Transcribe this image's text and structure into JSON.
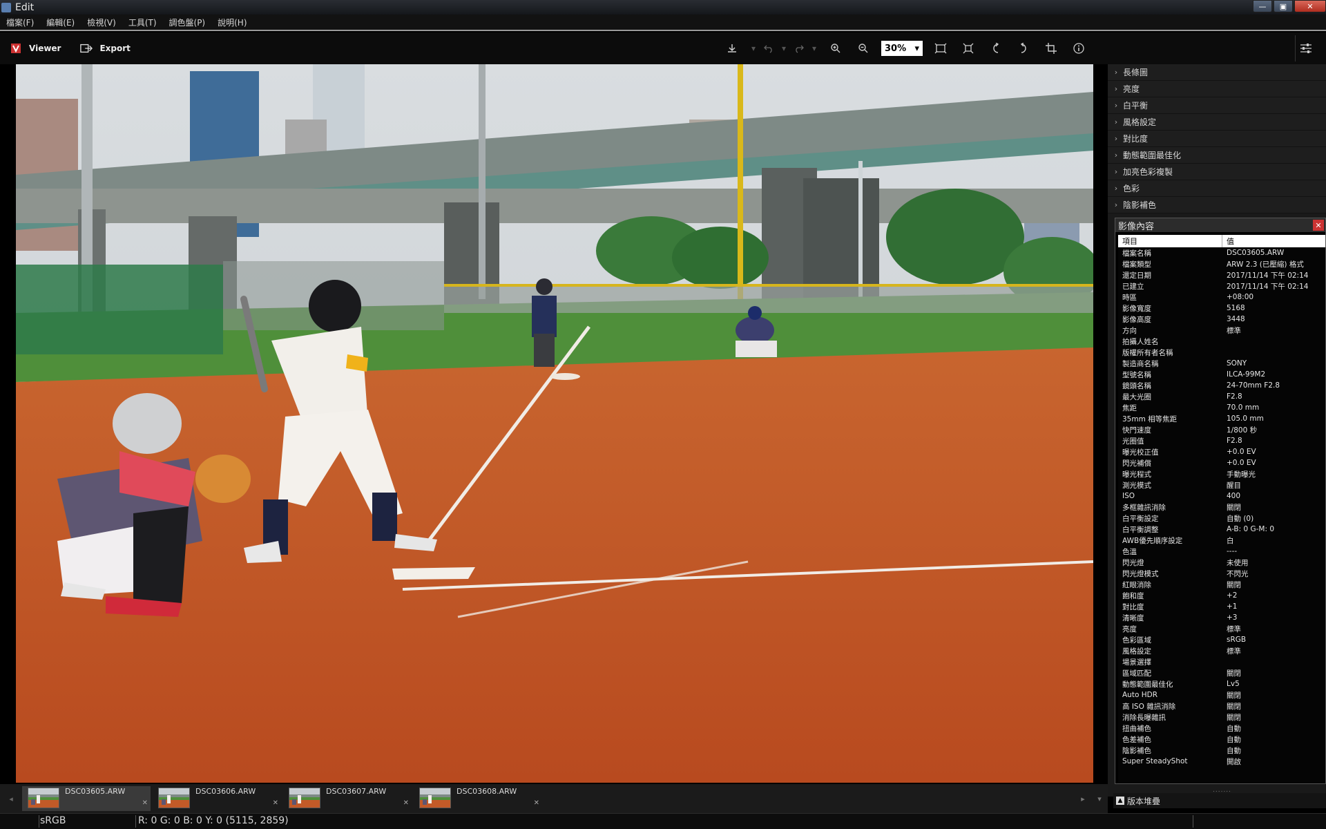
{
  "window": {
    "title": "Edit"
  },
  "menu": [
    "檔案(F)",
    "編輯(E)",
    "檢視(V)",
    "工具(T)",
    "調色盤(P)",
    "說明(H)"
  ],
  "toolbar": {
    "viewer_label": "Viewer",
    "export_label": "Export",
    "zoom_value": "30%"
  },
  "adjustments": [
    "長條圖",
    "亮度",
    "白平衡",
    "風格設定",
    "對比度",
    "動態範圍最佳化",
    "加亮色彩複製",
    "色彩",
    "陰影補色"
  ],
  "properties": {
    "title": "影像內容",
    "col_item": "項目",
    "col_value": "值",
    "rows": [
      {
        "k": "檔案名稱",
        "v": "DSC03605.ARW"
      },
      {
        "k": "檔案類型",
        "v": "ARW 2.3 (已壓縮) 格式"
      },
      {
        "k": "還定日期",
        "v": "2017/11/14 下午 02:14"
      },
      {
        "k": "已建立",
        "v": "2017/11/14 下午 02:14"
      },
      {
        "k": "時區",
        "v": "+08:00"
      },
      {
        "k": "影像寬度",
        "v": "5168"
      },
      {
        "k": "影像高度",
        "v": "3448"
      },
      {
        "k": "方向",
        "v": "標準"
      },
      {
        "k": "拍攝人姓名",
        "v": ""
      },
      {
        "k": "版權所有者名稱",
        "v": ""
      },
      {
        "k": "製造商名稱",
        "v": "SONY"
      },
      {
        "k": "型號名稱",
        "v": "ILCA-99M2"
      },
      {
        "k": "鏡頭名稱",
        "v": "24-70mm F2.8"
      },
      {
        "k": "最大光圈",
        "v": "F2.8"
      },
      {
        "k": "焦距",
        "v": "70.0 mm"
      },
      {
        "k": "35mm 相等焦距",
        "v": "105.0 mm"
      },
      {
        "k": "快門速度",
        "v": "1/800 秒"
      },
      {
        "k": "光圈值",
        "v": "F2.8"
      },
      {
        "k": "曝光校正值",
        "v": "+0.0 EV"
      },
      {
        "k": "閃光補償",
        "v": "+0.0 EV"
      },
      {
        "k": "曝光程式",
        "v": "手動曝光"
      },
      {
        "k": "測光模式",
        "v": "醒目"
      },
      {
        "k": "ISO",
        "v": "400"
      },
      {
        "k": "多框雜訊消除",
        "v": "關閉"
      },
      {
        "k": "白平衡設定",
        "v": "自動 (0)"
      },
      {
        "k": "白平衡調整",
        "v": "A-B: 0 G-M: 0"
      },
      {
        "k": "AWB優先順序設定",
        "v": "白"
      },
      {
        "k": "色溫",
        "v": "----"
      },
      {
        "k": "閃光燈",
        "v": "未使用"
      },
      {
        "k": "閃光燈模式",
        "v": "不閃光"
      },
      {
        "k": "紅眼消除",
        "v": "關閉"
      },
      {
        "k": "飽和度",
        "v": "+2"
      },
      {
        "k": "對比度",
        "v": "+1"
      },
      {
        "k": "清晰度",
        "v": "+3"
      },
      {
        "k": "亮度",
        "v": "標準"
      },
      {
        "k": "色彩區域",
        "v": "sRGB"
      },
      {
        "k": "風格設定",
        "v": "標準"
      },
      {
        "k": "場景選擇",
        "v": ""
      },
      {
        "k": "區域匹配",
        "v": "關閉"
      },
      {
        "k": "動態範圍最佳化",
        "v": "Lv5"
      },
      {
        "k": "Auto HDR",
        "v": "關閉"
      },
      {
        "k": "高 ISO 雜訊消除",
        "v": "關閉"
      },
      {
        "k": "消除長曝雜訊",
        "v": "關閉"
      },
      {
        "k": "扭曲補色",
        "v": "自動"
      },
      {
        "k": "色差補色",
        "v": "自動"
      },
      {
        "k": "陰影補色",
        "v": "自動"
      },
      {
        "k": "Super SteadyShot",
        "v": "開啟"
      }
    ]
  },
  "version_stack_label": "版本堆疊",
  "filmstrip": [
    {
      "name": "DSC03605.ARW",
      "active": true
    },
    {
      "name": "DSC03606.ARW",
      "active": false
    },
    {
      "name": "DSC03607.ARW",
      "active": false
    },
    {
      "name": "DSC03608.ARW",
      "active": false
    }
  ],
  "status": {
    "color_space": "sRGB",
    "pixel_info": "R:  0  G:  0  B:  0  Y:  0    (5115, 2859)"
  },
  "colors": {
    "accent_red": "#c33",
    "infield": "#c8552a",
    "grass": "#4f8f3a"
  }
}
